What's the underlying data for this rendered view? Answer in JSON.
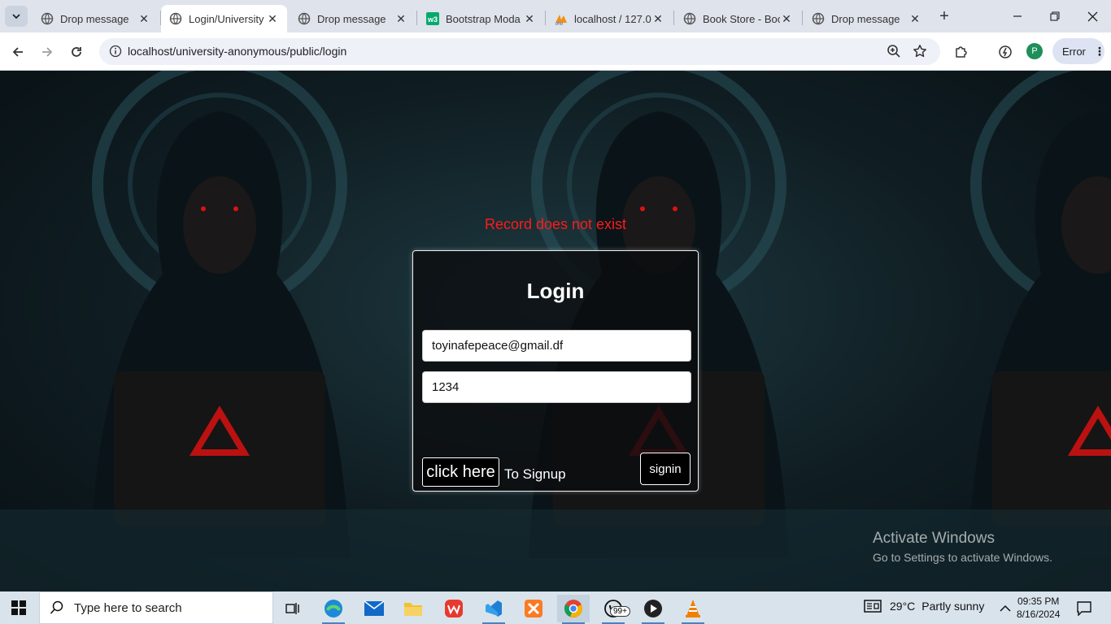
{
  "browser": {
    "tabs": [
      {
        "title": "Drop message",
        "icon": "globe-icon",
        "active": false
      },
      {
        "title": "Login/University",
        "icon": "globe-icon",
        "active": true
      },
      {
        "title": "Drop message",
        "icon": "globe-icon",
        "active": false
      },
      {
        "title": "Bootstrap Moda",
        "icon": "w3schools-icon",
        "active": false
      },
      {
        "title": "localhost / 127.0",
        "icon": "phpmyadmin-icon",
        "active": false
      },
      {
        "title": "Book Store - Boo",
        "icon": "globe-icon",
        "active": false
      },
      {
        "title": "Drop message",
        "icon": "globe-icon",
        "active": false
      }
    ],
    "url": "localhost/university-anonymous/public/login",
    "profile_initial": "P",
    "error_label": "Error"
  },
  "page": {
    "error_message": "Record does not exist",
    "login": {
      "title": "Login",
      "email_value": "toyinafepeace@gmail.df",
      "password_value": "1234",
      "click_here_label": "click here",
      "signup_text": "To Signup",
      "signin_label": "signin"
    },
    "watermark": {
      "line1": "Activate Windows",
      "line2": "Go to Settings to activate Windows."
    }
  },
  "taskbar": {
    "search_placeholder": "Type here to search",
    "apps": [
      "task-view-icon",
      "edge-icon",
      "mail-icon",
      "file-explorer-icon",
      "wps-icon",
      "vscode-icon",
      "xampp-icon",
      "chrome-icon",
      "whatsapp-icon",
      "media-player-icon",
      "vlc-icon"
    ],
    "whatsapp_badge": "99+",
    "weather": {
      "temp": "29°C",
      "condition": "Partly sunny"
    },
    "time": "09:35 PM",
    "date": "8/16/2024"
  }
}
